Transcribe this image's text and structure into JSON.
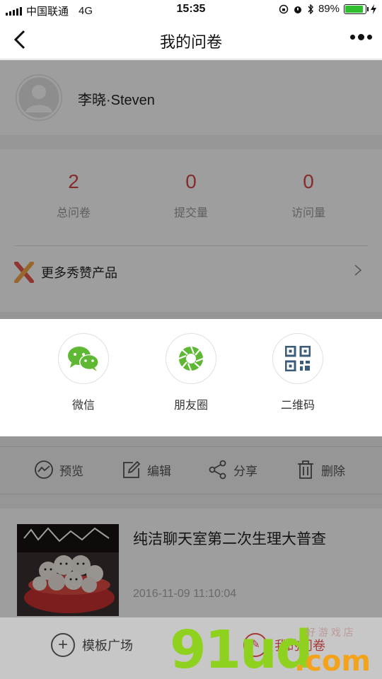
{
  "status_bar": {
    "carrier": "中国联通",
    "network": "4G",
    "time": "15:35",
    "battery": "89%",
    "battery_level": 0.89
  },
  "nav": {
    "title": "我的问卷"
  },
  "profile": {
    "name": "李晓·Steven"
  },
  "stats": [
    {
      "value": "2",
      "label": "总问卷"
    },
    {
      "value": "0",
      "label": "提交量"
    },
    {
      "value": "0",
      "label": "访问量"
    }
  ],
  "more_products": {
    "label": "更多秀赞产品"
  },
  "share": {
    "items": [
      {
        "label": "微信",
        "icon": "wechat-icon"
      },
      {
        "label": "朋友圈",
        "icon": "moments-icon"
      },
      {
        "label": "二维码",
        "icon": "qrcode-icon"
      }
    ]
  },
  "actions": [
    {
      "label": "预览",
      "icon": "preview-icon"
    },
    {
      "label": "编辑",
      "icon": "edit-icon"
    },
    {
      "label": "分享",
      "icon": "share-icon"
    },
    {
      "label": "删除",
      "icon": "trash-icon"
    }
  ],
  "survey": {
    "title": "纯洁聊天室第二次生理大普查",
    "date": "2016-11-09 11:10:04"
  },
  "tabbar": {
    "templates": "模板广场",
    "mine": "我的问卷"
  },
  "watermark": {
    "brand": "91ud",
    "tld": ".com",
    "tagline": "好 游 戏 店"
  },
  "colors": {
    "accent": "#d64a4a",
    "wechat_green": "#5fb833",
    "qrcode_blue": "#3a5c7a"
  }
}
